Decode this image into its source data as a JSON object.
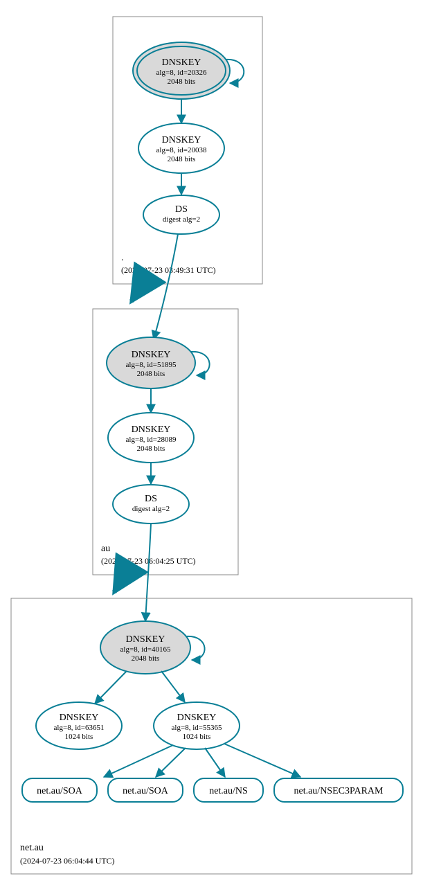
{
  "colors": {
    "accent": "#0a7f96",
    "fill": "#d9d9d9"
  },
  "zones": {
    "root": {
      "name": ".",
      "timestamp": "(2024-07-23 03:49:31 UTC)"
    },
    "au": {
      "name": "au",
      "timestamp": "(2024-07-23 06:04:25 UTC)"
    },
    "netau": {
      "name": "net.au",
      "timestamp": "(2024-07-23 06:04:44 UTC)"
    }
  },
  "nodes": {
    "root_ksk": {
      "title": "DNSKEY",
      "line2": "alg=8, id=20326",
      "line3": "2048 bits"
    },
    "root_zsk": {
      "title": "DNSKEY",
      "line2": "alg=8, id=20038",
      "line3": "2048 bits"
    },
    "root_ds": {
      "title": "DS",
      "line2": "digest alg=2"
    },
    "au_ksk": {
      "title": "DNSKEY",
      "line2": "alg=8, id=51895",
      "line3": "2048 bits"
    },
    "au_zsk": {
      "title": "DNSKEY",
      "line2": "alg=8, id=28089",
      "line3": "2048 bits"
    },
    "au_ds": {
      "title": "DS",
      "line2": "digest alg=2"
    },
    "netau_ksk": {
      "title": "DNSKEY",
      "line2": "alg=8, id=40165",
      "line3": "2048 bits"
    },
    "netau_zsk1": {
      "title": "DNSKEY",
      "line2": "alg=8, id=63651",
      "line3": "1024 bits"
    },
    "netau_zsk2": {
      "title": "DNSKEY",
      "line2": "alg=8, id=55365",
      "line3": "1024 bits"
    }
  },
  "rrsets": {
    "soa1": "net.au/SOA",
    "soa2": "net.au/SOA",
    "ns": "net.au/NS",
    "nsec3": "net.au/NSEC3PARAM"
  },
  "chart_data": {
    "type": "diagram",
    "description": "DNSSEC delegation / chain-of-trust graph",
    "zones": [
      {
        "name": ".",
        "timestamp": "2024-07-23 03:49:31 UTC",
        "records": [
          {
            "id": "root_ksk",
            "type": "DNSKEY",
            "alg": 8,
            "key_id": 20326,
            "bits": 2048,
            "role": "KSK_trust_anchor",
            "self_signed": true
          },
          {
            "id": "root_zsk",
            "type": "DNSKEY",
            "alg": 8,
            "key_id": 20038,
            "bits": 2048
          },
          {
            "id": "root_ds",
            "type": "DS",
            "digest_alg": 2
          }
        ]
      },
      {
        "name": "au",
        "timestamp": "2024-07-23 06:04:25 UTC",
        "records": [
          {
            "id": "au_ksk",
            "type": "DNSKEY",
            "alg": 8,
            "key_id": 51895,
            "bits": 2048,
            "role": "KSK",
            "self_signed": true
          },
          {
            "id": "au_zsk",
            "type": "DNSKEY",
            "alg": 8,
            "key_id": 28089,
            "bits": 2048
          },
          {
            "id": "au_ds",
            "type": "DS",
            "digest_alg": 2
          }
        ]
      },
      {
        "name": "net.au",
        "timestamp": "2024-07-23 06:04:44 UTC",
        "records": [
          {
            "id": "netau_ksk",
            "type": "DNSKEY",
            "alg": 8,
            "key_id": 40165,
            "bits": 2048,
            "role": "KSK",
            "self_signed": true
          },
          {
            "id": "netau_zsk1",
            "type": "DNSKEY",
            "alg": 8,
            "key_id": 63651,
            "bits": 1024
          },
          {
            "id": "netau_zsk2",
            "type": "DNSKEY",
            "alg": 8,
            "key_id": 55365,
            "bits": 1024
          },
          {
            "id": "rr_soa1",
            "type": "RRset",
            "name": "net.au/SOA"
          },
          {
            "id": "rr_soa2",
            "type": "RRset",
            "name": "net.au/SOA"
          },
          {
            "id": "rr_ns",
            "type": "RRset",
            "name": "net.au/NS"
          },
          {
            "id": "rr_nsec3",
            "type": "RRset",
            "name": "net.au/NSEC3PARAM"
          }
        ]
      }
    ],
    "edges": [
      {
        "from": "root_ksk",
        "to": "root_ksk",
        "kind": "self-sign"
      },
      {
        "from": "root_ksk",
        "to": "root_zsk"
      },
      {
        "from": "root_zsk",
        "to": "root_ds"
      },
      {
        "from": "root_ds",
        "to": "au_ksk"
      },
      {
        "from": "zone:.",
        "to": "zone:au",
        "kind": "delegation"
      },
      {
        "from": "au_ksk",
        "to": "au_ksk",
        "kind": "self-sign"
      },
      {
        "from": "au_ksk",
        "to": "au_zsk"
      },
      {
        "from": "au_zsk",
        "to": "au_ds"
      },
      {
        "from": "au_ds",
        "to": "netau_ksk"
      },
      {
        "from": "zone:au",
        "to": "zone:net.au",
        "kind": "delegation"
      },
      {
        "from": "netau_ksk",
        "to": "netau_ksk",
        "kind": "self-sign"
      },
      {
        "from": "netau_ksk",
        "to": "netau_zsk1"
      },
      {
        "from": "netau_ksk",
        "to": "netau_zsk2"
      },
      {
        "from": "netau_zsk2",
        "to": "rr_soa1"
      },
      {
        "from": "netau_zsk2",
        "to": "rr_soa2"
      },
      {
        "from": "netau_zsk2",
        "to": "rr_ns"
      },
      {
        "from": "netau_zsk2",
        "to": "rr_nsec3"
      }
    ]
  }
}
